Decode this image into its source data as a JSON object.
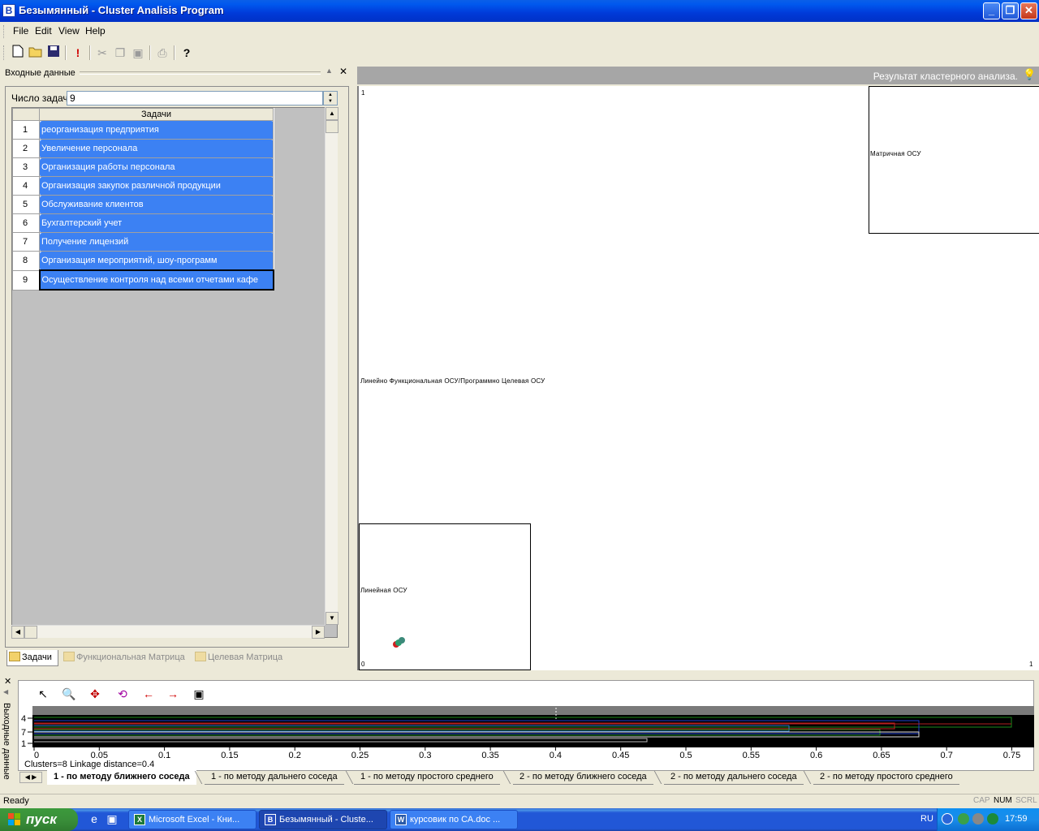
{
  "window": {
    "title": "Безымянный - Cluster Analisis Program",
    "minimize": "_",
    "maximize": "❐",
    "close": "✕"
  },
  "menu": [
    "File",
    "Edit",
    "View",
    "Help"
  ],
  "toolbar_icons": [
    "new-file-icon",
    "open-folder-icon",
    "save-icon",
    "run-icon",
    "cut-icon",
    "copy-icon",
    "paste-icon",
    "print-icon",
    "help-icon"
  ],
  "left_panel": {
    "caption": "Входные данные",
    "count_label": "Число задач",
    "count_value": "9",
    "grid": {
      "header": "Задачи",
      "rows": [
        {
          "n": "1",
          "task": "реорганизация предприятия"
        },
        {
          "n": "2",
          "task": "Увеличение персонала"
        },
        {
          "n": "3",
          "task": "Организация работы персонала"
        },
        {
          "n": "4",
          "task": "Организация закупок различной продукции"
        },
        {
          "n": "5",
          "task": "Обслуживание клиентов"
        },
        {
          "n": "6",
          "task": "Бухгалтерский учет"
        },
        {
          "n": "7",
          "task": "Получение лицензий"
        },
        {
          "n": "8",
          "task": "Организация мероприятий, шоу-программ"
        },
        {
          "n": "9",
          "task": "Осуществление контроля над всеми отчетами кафе"
        }
      ]
    },
    "tabs": [
      "Задачи",
      "Функциональная Матрица",
      "Целевая Матрица"
    ]
  },
  "result_panel": {
    "title": "Результат кластерного анализа.",
    "clusters": [
      {
        "label": "Матричная ОСУ"
      },
      {
        "label": "Линейно Функциональная ОСУ/Программно Целевая ОСУ"
      },
      {
        "label": "Линейная ОСУ"
      }
    ],
    "axis": {
      "top_left": "1",
      "bottom_left": "0",
      "bottom_right": "1"
    }
  },
  "bottom_panel": {
    "caption": "Выходные данные",
    "linkage_text": "Clusters=8 Linkage distance=0.4",
    "y_ticks": [
      "4",
      "7",
      "1"
    ],
    "x_ticks": [
      "0",
      "0.05",
      "0.1",
      "0.15",
      "0.2",
      "0.25",
      "0.3",
      "0.35",
      "0.4",
      "0.45",
      "0.5",
      "0.55",
      "0.6",
      "0.65",
      "0.7",
      "0.75"
    ],
    "tabs": [
      "1 - по методу ближнего соседа",
      "1 - по методу дальнего соседа",
      "1 - по методу простого среднего",
      "2 - по методу ближнего соседа",
      "2 - по методу дальнего соседа",
      "2 - по методу простого среднего"
    ]
  },
  "status": {
    "text": "Ready",
    "cap": "CAP",
    "num": "NUM",
    "scrl": "SCRL"
  },
  "taskbar": {
    "start": "пуск",
    "tasks": [
      {
        "label": "Microsoft Excel - Кни..."
      },
      {
        "label": "Безымянный - Cluste..."
      },
      {
        "label": "курсовик по СА.doc ..."
      }
    ],
    "lang": "RU",
    "clock": "17:59"
  },
  "colors": {
    "titlebar": "#0054e3",
    "panel_header": "#a6a6a6",
    "dendrogram_bg": "#000000",
    "start_green": "#3a8f3a"
  }
}
